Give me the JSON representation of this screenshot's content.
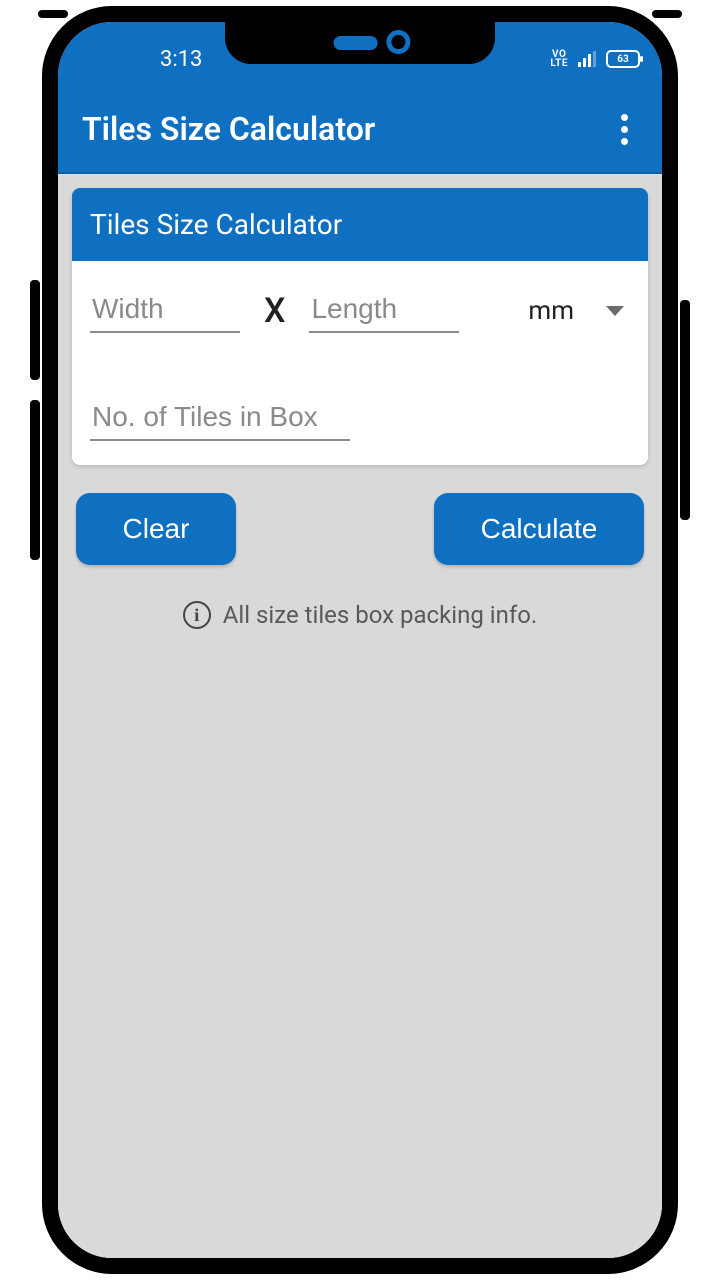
{
  "status": {
    "time": "3:13",
    "volte": "VO\nLTE",
    "battery": "63"
  },
  "appbar": {
    "title": "Tiles Size Calculator"
  },
  "card": {
    "header": "Tiles Size Calculator",
    "width_placeholder": "Width",
    "separator": "X",
    "length_placeholder": "Length",
    "unit_value": "mm",
    "tiles_placeholder": "No. of Tiles in Box"
  },
  "buttons": {
    "clear": "Clear",
    "calculate": "Calculate"
  },
  "info": {
    "text": "All size tiles box packing info."
  }
}
